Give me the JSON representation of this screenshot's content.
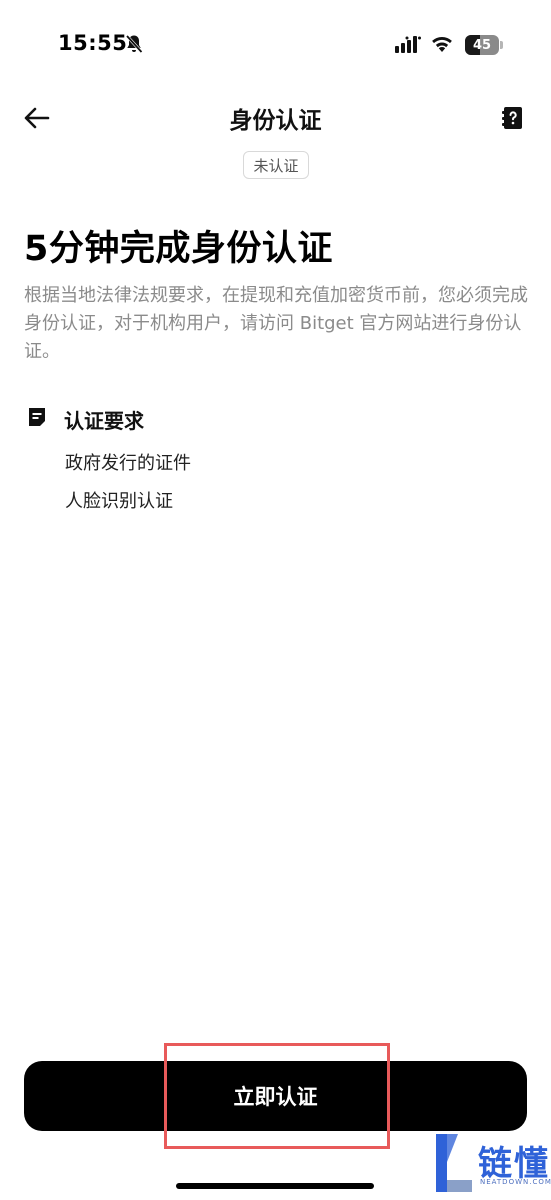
{
  "status_bar": {
    "time": "15:55",
    "battery_level": "45",
    "battery_fraction": 0.45,
    "icons": [
      "bell-slash-icon",
      "signal-icon",
      "wifi-icon",
      "battery-icon"
    ]
  },
  "nav": {
    "back_icon": "arrow-left-icon",
    "title": "身份认证",
    "help_icon": "help-book-icon"
  },
  "verification_status": "未认证",
  "headline": "5分钟完成身份认证",
  "description": "根据当地法律法规要求，在提现和充值加密货币前，您必须完成身份认证，对于机构用户，请访问 Bitget 官方网站进行身份认证。",
  "requirements": {
    "icon": "document-icon",
    "title": "认证要求",
    "items": [
      "政府发行的证件",
      "人脸识别认证"
    ]
  },
  "primary_button": {
    "label": "立即认证"
  },
  "watermark": {
    "text": "链懂",
    "subtext": "NEATDOWN.COM"
  },
  "colors": {
    "accent": "#000000",
    "highlight": "#e85a5a",
    "description_text": "#8b8b8b",
    "watermark": "#2f62d8"
  }
}
